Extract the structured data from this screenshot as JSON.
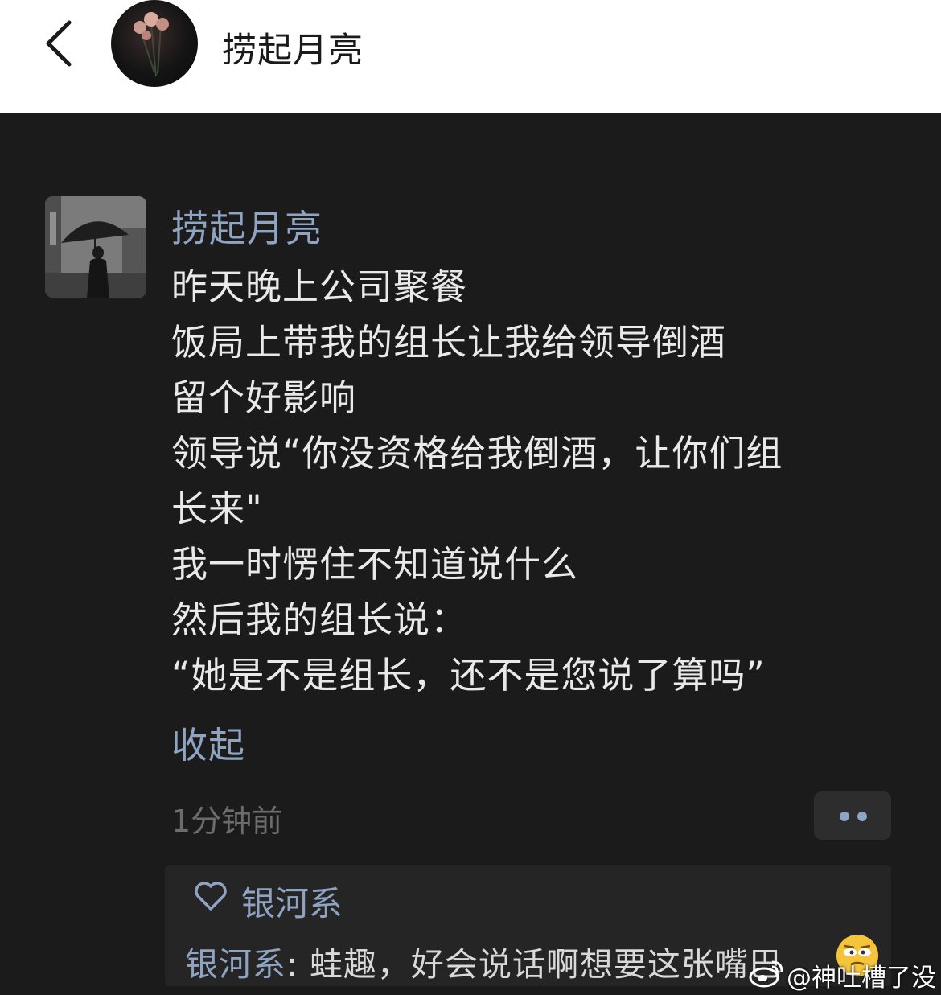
{
  "header": {
    "title": "捞起月亮"
  },
  "post": {
    "author": "捞起月亮",
    "lines": [
      "昨天晚上公司聚餐",
      "饭局上带我的组长让我给领导倒酒",
      "留个好影响",
      "领导说“你没资格给我倒酒，让你们组",
      "长来\"",
      "我一时愣住不知道说什么",
      "然后我的组长说：",
      "“她是不是组长，还不是您说了算吗”"
    ],
    "collapse_label": "收起",
    "timestamp": "1分钟前"
  },
  "likes": {
    "icon": "heart-outline-icon",
    "names": "银河系"
  },
  "comments": [
    {
      "author": "银河系",
      "separator": ": ",
      "text": "蛙趣，好会说话啊想要这张嘴巴"
    }
  ],
  "watermark": {
    "text": "@神吐槽了没"
  },
  "colors": {
    "background": "#1b1b1b",
    "link": "#8fa3c3",
    "body_text": "#e9e9e9",
    "muted": "#6c6c6c"
  }
}
